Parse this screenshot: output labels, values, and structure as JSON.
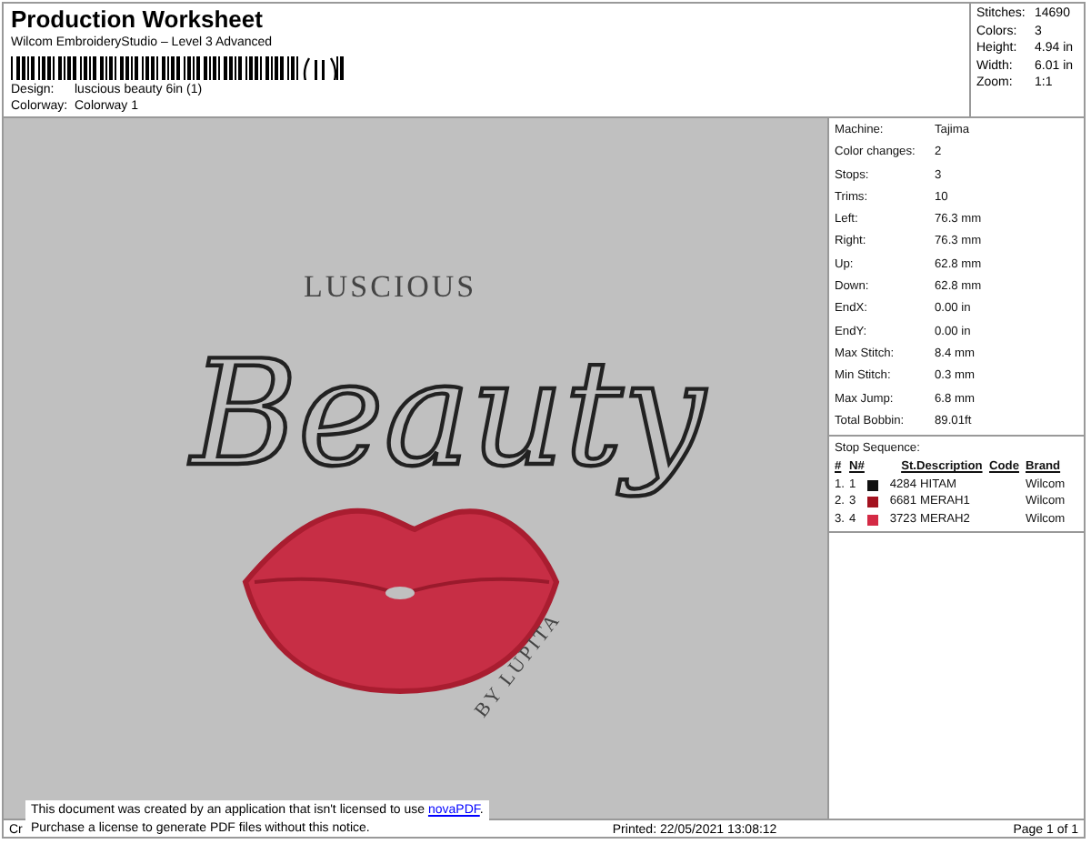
{
  "header": {
    "title": "Production Worksheet",
    "subtitle": "Wilcom EmbroideryStudio – Level 3 Advanced",
    "fields": [
      {
        "label": "Design:",
        "value": "luscious beauty 6in (1)"
      },
      {
        "label": "Colorway:",
        "value": "Colorway 1"
      }
    ]
  },
  "summary": [
    {
      "label": "Stitches:",
      "value": "14690"
    },
    {
      "label": "Colors:",
      "value": "3"
    },
    {
      "label": "Height:",
      "value": "4.94 in"
    },
    {
      "label": "Width:",
      "value": "6.01 in"
    },
    {
      "label": "Zoom:",
      "value": "1:1"
    }
  ],
  "design_preview": {
    "top_text": "LUSCIOUS",
    "script_text": "Beauty",
    "curved_text": "BY LUPITA"
  },
  "details": [
    {
      "label": "Machine:",
      "value": "Tajima"
    },
    {
      "label": "Color changes:",
      "value": "2"
    },
    {
      "label": "Stops:",
      "value": "3"
    },
    {
      "label": "Trims:",
      "value": "10"
    },
    {
      "label": "Left:",
      "value": "76.3 mm"
    },
    {
      "label": "Right:",
      "value": "76.3 mm"
    },
    {
      "label": "Up:",
      "value": "62.8 mm"
    },
    {
      "label": "Down:",
      "value": "62.8 mm"
    },
    {
      "label": "EndX:",
      "value": "0.00 in"
    },
    {
      "label": "EndY:",
      "value": "0.00 in"
    },
    {
      "label": "Max Stitch:",
      "value": "8.4 mm"
    },
    {
      "label": "Min Stitch:",
      "value": "0.3 mm"
    },
    {
      "label": "Max Jump:",
      "value": "6.8 mm"
    },
    {
      "label": "Total Bobbin:",
      "value": "89.01ft"
    }
  ],
  "stop_sequence": {
    "title": "Stop Sequence:",
    "columns": [
      "#",
      "N#",
      "St.",
      "Description",
      "Code",
      "Brand"
    ],
    "rows": [
      {
        "index": "1.",
        "needle": "1",
        "color": "#111111",
        "stitches": "4284",
        "description": "HITAM",
        "code": "",
        "brand": "Wilcom"
      },
      {
        "index": "2.",
        "needle": "3",
        "color": "#a3121f",
        "stitches": "6681",
        "description": "MERAH1",
        "code": "",
        "brand": "Wilcom"
      },
      {
        "index": "3.",
        "needle": "4",
        "color": "#d42a45",
        "stitches": "3723",
        "description": "MERAH2",
        "code": "",
        "brand": "Wilcom"
      }
    ]
  },
  "footer": {
    "left": "Cr",
    "printed": "Printed: 22/05/2021 13:08:12",
    "page": "Page 1 of 1"
  },
  "notice": {
    "line_1": "This document was created by an application that isn't licensed to use ",
    "link": "novaPDF",
    "line_1_end": ".",
    "line_2": "Purchase a license to generate PDF files without this notice."
  }
}
